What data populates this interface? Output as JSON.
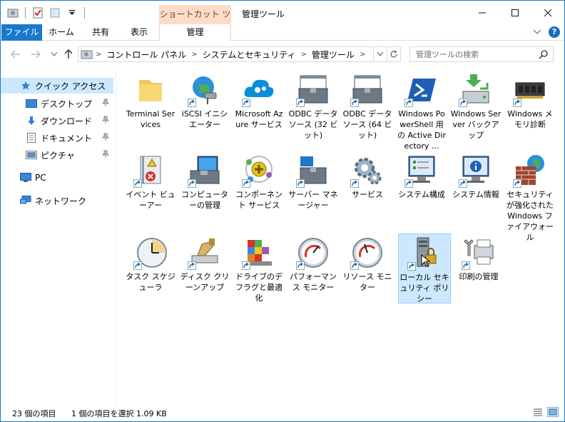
{
  "window": {
    "title": "管理ツール",
    "contextual_tab_group": "ショートカット ツール",
    "controls": {
      "minimize": "—",
      "maximize": "☐",
      "close": "✕"
    }
  },
  "ribbon": {
    "tabs": [
      {
        "label": "ファイル"
      },
      {
        "label": "ホーム"
      },
      {
        "label": "共有"
      },
      {
        "label": "表示"
      },
      {
        "label": "管理"
      }
    ],
    "expand_glyph": "⌄",
    "help_glyph": "?"
  },
  "address": {
    "crumbs": [
      "コントロール パネル",
      "システムとセキュリティ",
      "管理ツール"
    ],
    "search_placeholder": "管理ツールの検索"
  },
  "sidebar": {
    "items": [
      {
        "label": "クイック アクセス",
        "icon": "star-icon",
        "pinned": false
      },
      {
        "label": "デスクトップ",
        "icon": "desktop-icon",
        "pinned": true
      },
      {
        "label": "ダウンロード",
        "icon": "download-icon",
        "pinned": true
      },
      {
        "label": "ドキュメント",
        "icon": "document-icon",
        "pinned": true
      },
      {
        "label": "ピクチャ",
        "icon": "pictures-icon",
        "pinned": true
      },
      {
        "label": "PC",
        "icon": "pc-icon",
        "pinned": false
      },
      {
        "label": "ネットワーク",
        "icon": "network-icon",
        "pinned": false
      }
    ]
  },
  "items": [
    {
      "label": "Terminal Services",
      "icon": "folder-icon"
    },
    {
      "label": "iSCSI イニシエーター",
      "icon": "iscsi-globe-icon"
    },
    {
      "label": "Microsoft Azure サービス",
      "icon": "azure-cloud-icon"
    },
    {
      "label": "ODBC データ ソース (32 ビット)",
      "icon": "odbc-toolbox-icon"
    },
    {
      "label": "ODBC データ ソース (64 ビット)",
      "icon": "odbc-toolbox-icon"
    },
    {
      "label": "Windows PowerShell 用の Active Directory ...",
      "icon": "powershell-icon"
    },
    {
      "label": "Windows Server バックアップ",
      "icon": "server-backup-icon"
    },
    {
      "label": "Windows メモリ診断",
      "icon": "memory-chip-icon"
    },
    {
      "label": "イベント ビューアー",
      "icon": "event-viewer-icon"
    },
    {
      "label": "コンピューターの管理",
      "icon": "computer-management-icon"
    },
    {
      "label": "コンポーネント サービス",
      "icon": "component-services-icon"
    },
    {
      "label": "サーバー マネージャー",
      "icon": "server-manager-icon"
    },
    {
      "label": "サービス",
      "icon": "services-gear-icon"
    },
    {
      "label": "システム構成",
      "icon": "system-config-icon"
    },
    {
      "label": "システム情報",
      "icon": "system-info-icon"
    },
    {
      "label": "セキュリティが強化された Windows ファイアウォール",
      "icon": "firewall-icon"
    },
    {
      "label": "タスク スケジューラ",
      "icon": "clock-icon"
    },
    {
      "label": "ディスク クリーンアップ",
      "icon": "disk-cleanup-icon"
    },
    {
      "label": "ドライブのデフラグと最適化",
      "icon": "defrag-icon"
    },
    {
      "label": "パフォーマンス モニター",
      "icon": "gauge-icon"
    },
    {
      "label": "リソース モニター",
      "icon": "gauge-icon"
    },
    {
      "label": "ローカル セキュリティ ポリシー",
      "icon": "security-policy-icon",
      "selected": true
    },
    {
      "label": "印刷の管理",
      "icon": "print-management-icon"
    }
  ],
  "status": {
    "count": "23 個の項目",
    "selection": "1 個の項目を選択  1.09 KB"
  }
}
